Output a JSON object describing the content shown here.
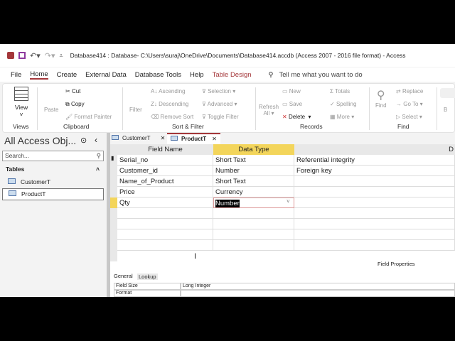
{
  "title": "Database414 : Database- C:\\Users\\suraj\\OneDrive\\Documents\\Database414.accdb (Access 2007 - 2016 file format)  -  Access",
  "menu": [
    "File",
    "Home",
    "Create",
    "External Data",
    "Database Tools",
    "Help",
    "Table Design"
  ],
  "tellme": "Tell me what you want to do",
  "ribbon": {
    "view": "View",
    "views": "Views",
    "paste": "Paste",
    "cut": "Cut",
    "copy": "Copy",
    "format_painter": "Format Painter",
    "clipboard": "Clipboard",
    "filter": "Filter",
    "ascending": "Ascending",
    "descending": "Descending",
    "remove_sort": "Remove Sort",
    "selection": "Selection",
    "advanced": "Advanced",
    "toggle_filter": "Toggle Filter",
    "sort_filter": "Sort & Filter",
    "refresh": "Refresh",
    "all": "All",
    "new": "New",
    "save": "Save",
    "delete": "Delete",
    "totals": "Totals",
    "spelling": "Spelling",
    "more": "More",
    "records": "Records",
    "find": "Find",
    "replace": "Replace",
    "goto": "Go To",
    "select": "Select",
    "find_group": "Find",
    "b": "B"
  },
  "nav": {
    "title": "All Access Obj...",
    "search_placeholder": "Search...",
    "section": "Tables",
    "items": [
      "CustomerT",
      "ProductT"
    ]
  },
  "doc_tabs": [
    "CustomerT",
    "ProductT"
  ],
  "grid": {
    "headers": [
      "Field Name",
      "Data Type",
      "D"
    ],
    "rows": [
      [
        "Serial_no",
        "Short Text",
        "Referential integrity"
      ],
      [
        "Customer_id",
        "Number",
        "Foreign key"
      ],
      [
        "Name_of_Product",
        "Short Text",
        ""
      ],
      [
        "Price",
        "Currency",
        ""
      ],
      [
        "Qty",
        "Number",
        ""
      ]
    ]
  },
  "props": {
    "title": "Field Properties",
    "tabs": [
      "General",
      "Lookup"
    ],
    "rows": [
      [
        "Field Size",
        "Long Integer"
      ],
      [
        "Format",
        ""
      ]
    ]
  }
}
